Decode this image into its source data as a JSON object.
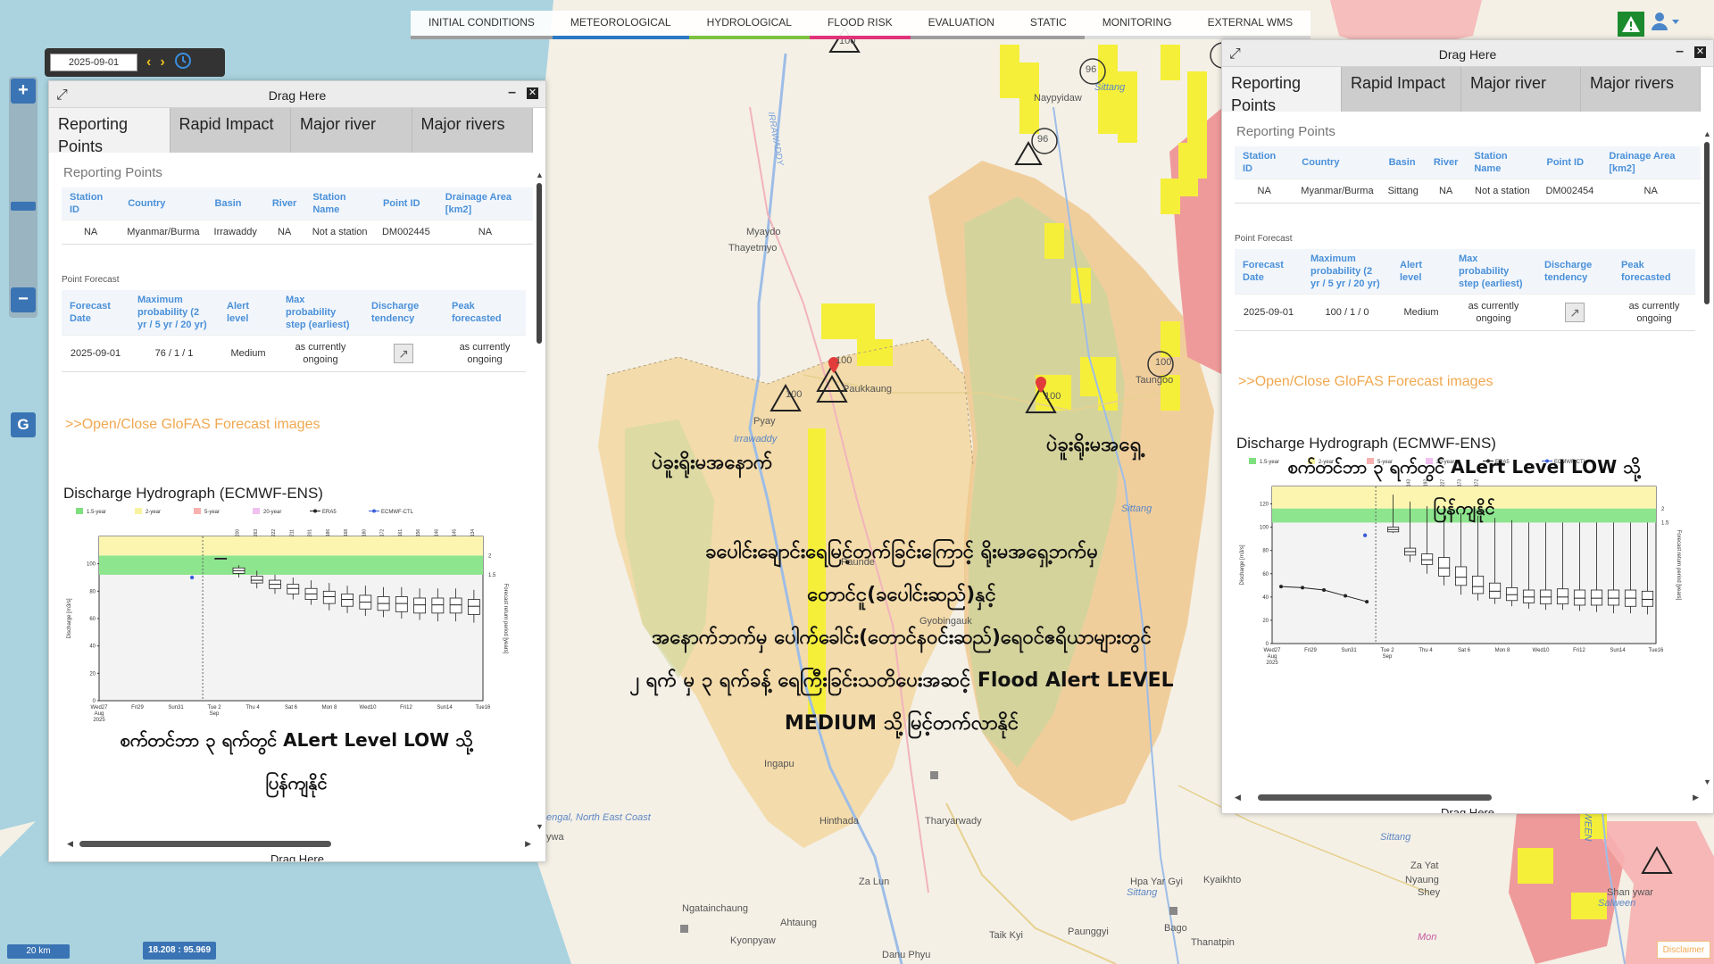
{
  "nav": {
    "tabs": [
      {
        "label": "INITIAL CONDITIONS",
        "color": "#9e9e9e"
      },
      {
        "label": "METEOROLOGICAL",
        "color": "#2b78c4"
      },
      {
        "label": "HYDROLOGICAL",
        "color": "#7cc242"
      },
      {
        "label": "FLOOD RISK",
        "color": "#e0337a"
      },
      {
        "label": "EVALUATION",
        "color": "#9e9e9e"
      },
      {
        "label": "STATIC",
        "color": "#9e9e9e"
      },
      {
        "label": "MONITORING",
        "color": "#dcdcdc"
      },
      {
        "label": "EXTERNAL WMS",
        "color": "#dcdcdc"
      }
    ]
  },
  "toolbar": {
    "date": "2025-09-01"
  },
  "zoom": {
    "plus": "+",
    "minus": "−",
    "g": "G"
  },
  "map": {
    "labels": {
      "naypyidaw": "Naypyidaw",
      "sittang1": "Sittang",
      "irrawaddy_river": "IRRAWADDY",
      "myaydo": "Myaydo",
      "thayetmyo": "Thayetmyo",
      "paukkaung": "Paukkaung",
      "pyay": "Pyay",
      "irrawaddy": "Irrawaddy",
      "taungoo": "Taungoo",
      "sittang2": "Sittang",
      "paunde": "Paunde",
      "gyobingauk": "Gyobingauk",
      "ingapu": "Ingapu",
      "tharyarwady": "Tharyarwady",
      "hinthada": "Hinthada",
      "bengal": "engal, North East Coast",
      "zalun": "Za Lun",
      "ngataingchaung": "Ngatainchaung",
      "ahtaung": "Ahtaung",
      "kyonpyaw": "Kyonpyaw",
      "danuphyu": "Danu Phyu",
      "taikkyi": "Taik Kyi",
      "paunggyi": "Paunggyi",
      "hpayargyi": "Hpa Yar Gyi",
      "sittang3": "Sittang",
      "kyaikhto": "Kyaikhto",
      "bago": "Bago",
      "thanatpin": "Thanatpin",
      "sittang4": "Sittang",
      "zayathi": "Za Yat",
      "nyaung": "Nyaung",
      "shey": "Shey",
      "mon": "Mon",
      "shanywar": "Shan ywar",
      "salween": "Salween",
      "salween_v": "WEEN",
      "ywa": "ywa"
    },
    "points": [
      "100",
      "100",
      "100",
      "100",
      "96",
      "96",
      "100"
    ]
  },
  "left_panel": {
    "drag_label": "Drag Here",
    "drag_label_bottom": "Drag Here",
    "tabs": [
      "Reporting Points",
      "Rapid Impact",
      "Major river",
      "Major rivers"
    ],
    "reporting_title": "Reporting Points",
    "station_headers": [
      "Station ID",
      "Country",
      "Basin",
      "River",
      "Station Name",
      "Point ID",
      "Drainage Area [km2]"
    ],
    "station_row": [
      "NA",
      "Myanmar/Burma",
      "Irrawaddy",
      "NA",
      "Not a station",
      "DM002445",
      "NA"
    ],
    "forecast_title": "Point Forecast",
    "forecast_headers": [
      "Forecast Date",
      "Maximum probability (2 yr / 5 yr / 20 yr)",
      "Alert level",
      "Max probability step (earliest)",
      "Discharge tendency",
      "Peak forecasted"
    ],
    "forecast_row": [
      "2025-09-01",
      "76 / 1 / 1",
      "Medium",
      "as currently ongoing",
      "",
      "as currently ongoing"
    ],
    "glofas_link": ">>Open/Close GloFAS Forecast images",
    "hydrograph_title": "Discharge Hydrograph (ECMWF-ENS)"
  },
  "right_panel": {
    "drag_label": "Drag Here",
    "drag_label_bottom": "Drag Here",
    "tabs": [
      "Reporting Points",
      "Rapid Impact",
      "Major river",
      "Major rivers"
    ],
    "reporting_title": "Reporting Points",
    "station_headers": [
      "Station ID",
      "Country",
      "Basin",
      "River",
      "Station Name",
      "Point ID",
      "Drainage Area [km2]"
    ],
    "station_row": [
      "NA",
      "Myanmar/Burma",
      "Sittang",
      "NA",
      "Not a station",
      "DM002454",
      "NA"
    ],
    "forecast_title": "Point Forecast",
    "forecast_headers": [
      "Forecast Date",
      "Maximum probability (2 yr / 5 yr / 20 yr)",
      "Alert level",
      "Max probability step (earliest)",
      "Discharge tendency",
      "Peak forecasted"
    ],
    "forecast_row": [
      "2025-09-01",
      "100 / 1 / 0",
      "Medium",
      "as currently ongoing",
      "",
      "as currently ongoing"
    ],
    "glofas_link": ">>Open/Close GloFAS Forecast images",
    "hydrograph_title": "Discharge Hydrograph (ECMWF-ENS)"
  },
  "legend": [
    "1.5-year",
    "2-year",
    "5-year",
    "20-year",
    "ERA5",
    "ECMWF-CTL"
  ],
  "chart_left": {
    "type": "box",
    "ylabel": "Discharge [m3/s]",
    "y2label": "Forecast return period [years]",
    "yticks": [
      "0",
      "20",
      "40",
      "60",
      "80",
      "100"
    ],
    "y2ticks": [
      "2",
      "1.5"
    ],
    "xticks": [
      "Wed27\nAug\n2025",
      "Fri29",
      "Sun31",
      "Tue 2\nSep",
      "Thu 4",
      "Sat 6",
      "Mon 8",
      "Wed10",
      "Fri12",
      "Sun14",
      "Tue16"
    ],
    "toplabels": [
      "200",
      "263",
      "222",
      "211",
      "201",
      "186",
      "168",
      "180",
      "172",
      "161",
      "156",
      "146",
      "145",
      "134"
    ],
    "ylim": [
      0,
      120
    ],
    "bands": {
      "rp15": 92,
      "rp2": 106
    },
    "era5": [],
    "ctl": [
      90
    ],
    "boxes": [
      [
        104,
        104,
        104,
        104,
        104
      ],
      [
        90,
        93,
        95,
        97,
        99
      ],
      [
        82,
        86,
        88,
        91,
        95
      ],
      [
        78,
        82,
        85,
        88,
        92
      ],
      [
        74,
        78,
        82,
        85,
        90
      ],
      [
        70,
        74,
        78,
        82,
        88
      ],
      [
        66,
        71,
        76,
        80,
        86
      ],
      [
        64,
        69,
        74,
        78,
        84
      ],
      [
        62,
        67,
        72,
        77,
        84
      ],
      [
        61,
        66,
        71,
        76,
        83
      ],
      [
        60,
        65,
        71,
        76,
        83
      ],
      [
        59,
        64,
        70,
        75,
        82
      ],
      [
        58,
        64,
        70,
        75,
        82
      ],
      [
        58,
        64,
        70,
        75,
        82
      ],
      [
        57,
        63,
        69,
        74,
        81
      ]
    ]
  },
  "chart_right": {
    "type": "box",
    "ylabel": "Discharge [m3/s]",
    "y2label": "Forecast return period [years]",
    "yticks": [
      "0",
      "20",
      "40",
      "60",
      "80",
      "100",
      "120"
    ],
    "y2ticks": [
      "2",
      "1.5"
    ],
    "xticks": [
      "Wed27\nAug\n2025",
      "Fri29",
      "Sun31",
      "Tue 2\nSep",
      "Thu 4",
      "Sat 6",
      "Mon 8",
      "Wed10",
      "Fri12",
      "Sun14",
      "Tue16"
    ],
    "toplabels": [
      "143",
      "192",
      "227",
      "173",
      "172"
    ],
    "ylim": [
      0,
      135
    ],
    "bands": {
      "rp15": 104,
      "rp2": 116
    },
    "era5": [
      49,
      48,
      46,
      41,
      36
    ],
    "ctl": [
      93
    ],
    "boxes": [
      [
        95,
        96,
        98,
        100,
        128
      ],
      [
        70,
        76,
        79,
        82,
        122
      ],
      [
        60,
        68,
        72,
        77,
        118
      ],
      [
        50,
        58,
        65,
        74,
        116
      ],
      [
        42,
        50,
        57,
        66,
        112
      ],
      [
        37,
        43,
        49,
        58,
        110
      ],
      [
        34,
        39,
        45,
        52,
        108
      ],
      [
        32,
        37,
        42,
        48,
        106
      ],
      [
        30,
        35,
        40,
        46,
        104
      ],
      [
        29,
        34,
        40,
        46,
        104
      ],
      [
        29,
        34,
        40,
        47,
        104
      ],
      [
        28,
        33,
        39,
        46,
        104
      ],
      [
        27,
        33,
        39,
        46,
        104
      ],
      [
        26,
        33,
        39,
        46,
        104
      ],
      [
        26,
        32,
        39,
        46,
        104
      ],
      [
        25,
        32,
        38,
        45,
        104
      ]
    ]
  },
  "overlays": {
    "west_basin": "ပဲခူးရိုးမအနောက်",
    "east_basin": "ပဲခူးရိုးမအရှေ့",
    "right_note_1": "စက်တင်ဘာ ၃ ရက်တွင် ALert Level LOW သို့",
    "right_note_2": "ပြန်ကျနိုင်",
    "center_1": "ခပေါင်းချောင်းရေမြင့်တက်ခြင်းကြောင့် ရိုးမအရှေ့ဘက်မှ",
    "center_2": "တောင်ငူ(ခပေါင်းဆည်)နှင့်",
    "center_3": "အနောက်ဘက်မှ ပေါက်ခေါင်း(တောင်နဝင်းဆည်)ရေဝင်ဧရိယာများတွင်",
    "center_4": "၂ ရက် မှ ၃ ရက်ခန့် ရေကြီးခြင်းသတိပေးအဆင့် Flood Alert LEVEL",
    "center_5": "MEDIUM သို့မြင့်တက်လာနိုင်",
    "left_note_1": "စက်တင်ဘာ ၃ ရက်တွင် ALert Level LOW သို့",
    "left_note_2": "ပြန်ကျနိုင်"
  },
  "footer": {
    "scale": "20 km",
    "coords": "18.208 : 95.969",
    "disclaimer": "Disclaimer"
  }
}
